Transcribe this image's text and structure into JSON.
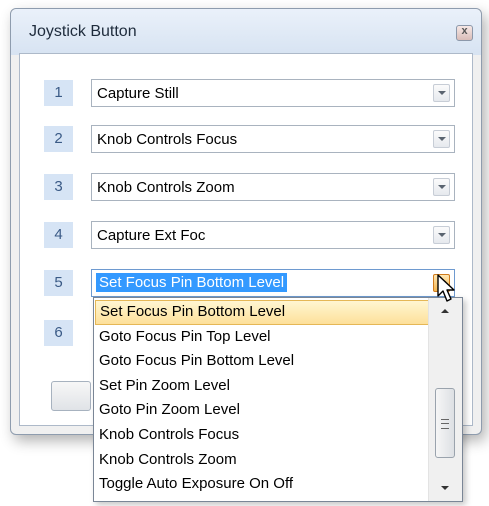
{
  "dialog": {
    "title": "Joystick Button",
    "close_glyph": "x"
  },
  "rows": [
    {
      "number": "1",
      "value": "Capture Still"
    },
    {
      "number": "2",
      "value": "Knob Controls Focus"
    },
    {
      "number": "3",
      "value": "Knob Controls Zoom"
    },
    {
      "number": "4",
      "value": "Capture Ext Foc"
    },
    {
      "number": "5",
      "value": "Set Focus Pin Bottom Level"
    },
    {
      "number": "6",
      "value": ""
    }
  ],
  "dropdown": {
    "items": [
      "Set Focus Pin Bottom Level",
      "Goto Focus Pin Top Level",
      "Goto Focus Pin Bottom Level",
      "Set Pin Zoom Level",
      "Goto Pin Zoom Level",
      "Knob Controls Focus",
      "Knob Controls Zoom",
      "Toggle Auto Exposure On Off"
    ],
    "selected_index": 0
  },
  "icons": {
    "close": "close-icon",
    "dropdown_arrow": "chevron-down-icon",
    "cursor": "mouse-pointer-icon"
  },
  "colors": {
    "number_badge_bg": "#d6e4f5",
    "selection_blue": "#3399ff",
    "hover_item_bg": "#fde09a"
  }
}
